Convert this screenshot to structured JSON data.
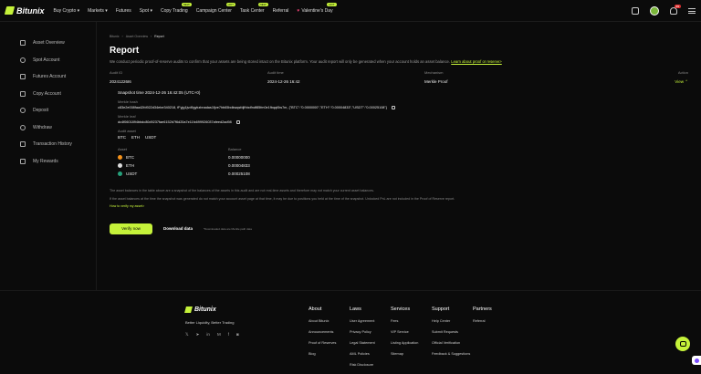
{
  "header": {
    "brand": "Bitunix",
    "nav": [
      {
        "label": "Buy Crypto ▾",
        "badge": ""
      },
      {
        "label": "Markets ▾",
        "badge": ""
      },
      {
        "label": "Futures",
        "badge": ""
      },
      {
        "label": "Spot ▾",
        "badge": ""
      },
      {
        "label": "Copy Trading",
        "badge": "NEW"
      },
      {
        "label": "Campaign Center",
        "badge": "HOT"
      },
      {
        "label": "Task Center",
        "badge": "NEW"
      },
      {
        "label": "Referral",
        "badge": ""
      },
      {
        "label": "Valentine's Day",
        "badge": "HOT"
      }
    ],
    "notification_count": "99"
  },
  "sidebar": {
    "items": [
      {
        "label": "Asset Overview",
        "icon": "wallet-icon"
      },
      {
        "label": "Spot Account",
        "icon": "spot-icon"
      },
      {
        "label": "Futures Account",
        "icon": "futures-icon"
      },
      {
        "label": "Copy Account",
        "icon": "copy-icon"
      },
      {
        "label": "Deposit",
        "icon": "deposit-icon"
      },
      {
        "label": "Withdraw",
        "icon": "withdraw-icon"
      },
      {
        "label": "Transaction History",
        "icon": "history-icon"
      },
      {
        "label": "My Rewards",
        "icon": "rewards-icon"
      }
    ]
  },
  "breadcrumb": [
    "Bitunix",
    "Asset Overview",
    "Report"
  ],
  "page": {
    "title": "Report",
    "description": "We conduct periodic proof-of-reserve audits to confirm that your assets are being stored intact on the Bitunix platform. Your audit report will only be generated when your account holds an asset balance.",
    "learn_link": "Learn about proof or reserve>"
  },
  "audit_table": {
    "headers": [
      "Audit ID",
      "Audit time",
      "Mechanism",
      "Action"
    ],
    "row": {
      "id": "20241226I6",
      "time": "2024-12-26 16:42",
      "mechanism": "Merkle Proof",
      "action": "View ⌃"
    }
  },
  "detail": {
    "snapshot": "Snapshot time 2024-12-26 16:42:05 (UTC+0)",
    "merkle_hash_label": "Merkle hash",
    "merkle_hash": "c83e2e008faa42fd922d34ebe340218, fFyjg1jvd9gykzbnadas1fjve7hb65bdkwqsfdjfhbdfndf85fm0e1fbqqt5w7m, {\"BTC\":\"0.0000000\",\"ETH\":\"0.00004833\",\"USDT\":\"0.00025108\"}",
    "merkle_leaf_label": "Merkle leaf",
    "merkle_leaf": "dc4f0601894bbdc80d9237fae6152b7f6d20a7e11fc699926037afeed2ad98",
    "audit_asset_label": "Audit asset",
    "audit_assets": [
      "BTC",
      "ETH",
      "USDT"
    ],
    "asset_header": "Asset",
    "balance_header": "Balance",
    "balances": [
      {
        "asset": "BTC",
        "balance": "0.00000000",
        "color": "#f7931a"
      },
      {
        "asset": "ETH",
        "balance": "0.00004833",
        "color": "#dddddd"
      },
      {
        "asset": "USDT",
        "balance": "0.00025108",
        "color": "#26a17b"
      }
    ]
  },
  "notes": {
    "line1": "The asset balances in the table above are a snapshot of the balances of the assets in this audit and are not real-time assets and therefore may not match your current asset balances.",
    "line2": "If the asset balances at the time the snapshot was generated do not match your account asset page at that time, it may be due to positions you held at the time of the snapshot. Unlocked PnL are not included in the Proof of Reserve report.",
    "link": "How to verify my asset>"
  },
  "actions": {
    "verify": "Verify now",
    "download": "Download data",
    "download_hint": "*Downloaded data are Merkle path data"
  },
  "footer": {
    "brand": "Bitunix",
    "tagline": "Better Liquidity, Better Trading",
    "social": [
      "𝕏",
      "➤",
      "in",
      "M",
      "f",
      "◙"
    ],
    "columns": [
      {
        "title": "About",
        "items": [
          "About Bitunix",
          "Announcements",
          "Proof of Reserves",
          "Blog"
        ]
      },
      {
        "title": "Laws",
        "items": [
          "User Agreement",
          "Privacy Policy",
          "Legal Statement",
          "AML Policies",
          "Risk Disclosure"
        ]
      },
      {
        "title": "Services",
        "items": [
          "Fees",
          "VIP Service",
          "Listing Application",
          "Sitemap"
        ]
      },
      {
        "title": "Support",
        "items": [
          "Help Center",
          "Submit Requests",
          "Official Verification",
          "Feedback & Suggestions"
        ]
      },
      {
        "title": "Partners",
        "items": [
          "Referral"
        ]
      }
    ]
  },
  "colors": {
    "accent": "#c5f23a",
    "bg": "#0b0b0b"
  }
}
